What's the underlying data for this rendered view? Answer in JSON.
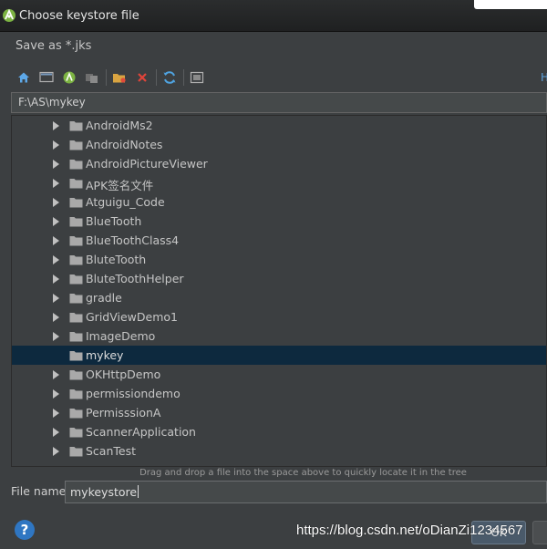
{
  "window": {
    "title": "Choose keystore file"
  },
  "dialog": {
    "subtitle": "Save as *.jks"
  },
  "toolbar": {
    "icons": [
      "home-icon",
      "desktop-icon",
      "android-project-icon",
      "module-icon",
      "new-folder-icon",
      "delete-icon",
      "refresh-icon",
      "show-hidden-icon"
    ]
  },
  "path": {
    "value": "F:\\AS\\mykey"
  },
  "tree": {
    "items": [
      {
        "label": "AndroidMs2",
        "expandable": true,
        "selected": false
      },
      {
        "label": "AndroidNotes",
        "expandable": true,
        "selected": false
      },
      {
        "label": "AndroidPictureViewer",
        "expandable": true,
        "selected": false
      },
      {
        "label": "APK签名文件",
        "expandable": true,
        "selected": false
      },
      {
        "label": "Atguigu_Code",
        "expandable": true,
        "selected": false
      },
      {
        "label": "BlueTooth",
        "expandable": true,
        "selected": false
      },
      {
        "label": "BlueToothClass4",
        "expandable": true,
        "selected": false
      },
      {
        "label": "BluteTooth",
        "expandable": true,
        "selected": false
      },
      {
        "label": "BluteToothHelper",
        "expandable": true,
        "selected": false
      },
      {
        "label": "gradle",
        "expandable": true,
        "selected": false
      },
      {
        "label": "GridViewDemo1",
        "expandable": true,
        "selected": false
      },
      {
        "label": "ImageDemo",
        "expandable": true,
        "selected": false
      },
      {
        "label": "mykey",
        "expandable": false,
        "selected": true
      },
      {
        "label": "OKHttpDemo",
        "expandable": true,
        "selected": false
      },
      {
        "label": "permissiondemo",
        "expandable": true,
        "selected": false
      },
      {
        "label": "PermisssionA",
        "expandable": true,
        "selected": false
      },
      {
        "label": "ScannerApplication",
        "expandable": true,
        "selected": false
      },
      {
        "label": "ScanTest",
        "expandable": true,
        "selected": false
      }
    ]
  },
  "hint": "Drag and drop a file into the space above to quickly locate it in the tree",
  "file_name": {
    "label": "File name:",
    "value": "mykeystore"
  },
  "buttons": {
    "help": "?",
    "ok": "OK"
  },
  "watermark": "https://blog.csdn.net/oDianZi1234567",
  "colors": {
    "background": "#3c3f41",
    "selection": "#0d293e",
    "text": "#bbbbbb",
    "accent": "#2f76c2"
  }
}
